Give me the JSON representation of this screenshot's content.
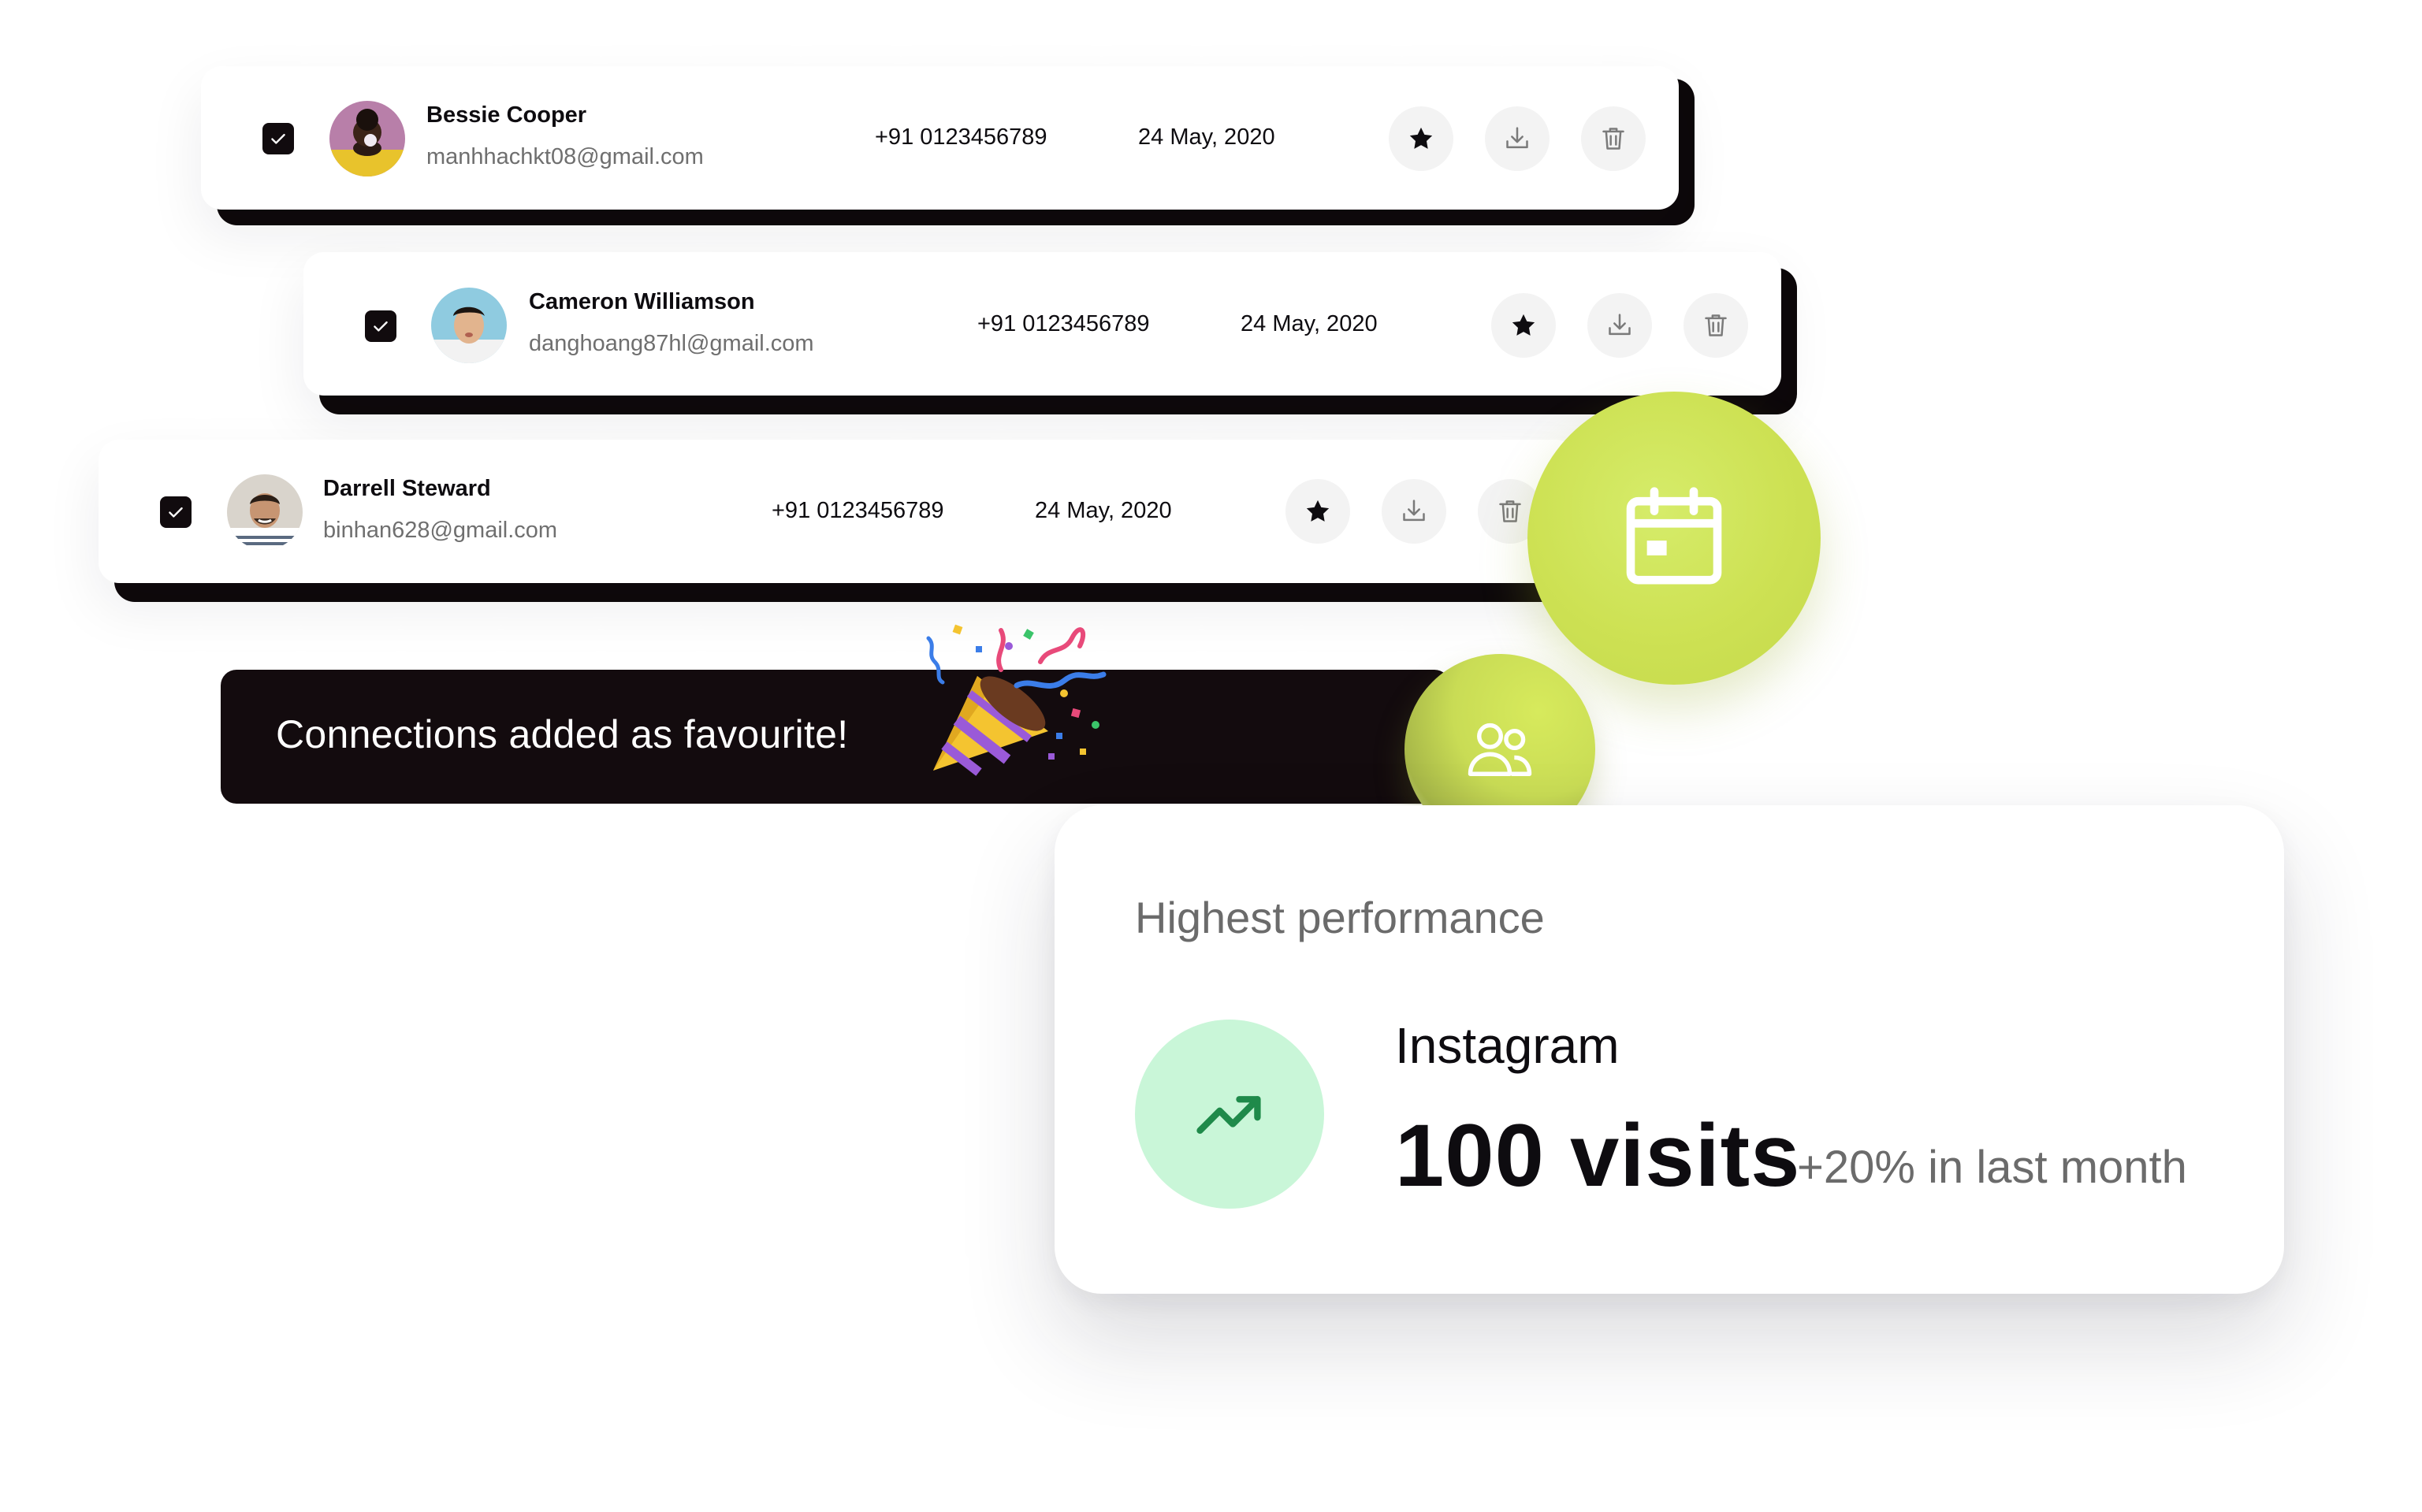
{
  "contacts": [
    {
      "name": "Bessie Cooper",
      "email": "manhhachkt08@gmail.com",
      "phone": "+91 0123456789",
      "date": "24 May, 2020",
      "checked": true
    },
    {
      "name": "Cameron Williamson",
      "email": "danghoang87hl@gmail.com",
      "phone": "+91 0123456789",
      "date": "24 May, 2020",
      "checked": true
    },
    {
      "name": "Darrell Steward",
      "email": "binhan628@gmail.com",
      "phone": "+91 0123456789",
      "date": "24 May, 2020",
      "checked": true
    }
  ],
  "row_actions": {
    "star_icon": "star-icon",
    "download_icon": "download-icon",
    "delete_icon": "trash-icon"
  },
  "toast": {
    "message": "Connections added as favourite!",
    "emoji": "party-popper"
  },
  "badges": {
    "calendar_icon": "calendar-icon",
    "users_icon": "users-icon"
  },
  "performance": {
    "title": "Highest performance",
    "platform": "Instagram",
    "visits": "100 visits",
    "change": "+20% in last month",
    "trend_icon": "trending-up-icon"
  },
  "colors": {
    "accent": "#cde153",
    "dark": "#130b0e",
    "trend_bg": "#c9f6d8",
    "trend_icon": "#1f8a4a",
    "muted": "#6f6f6f"
  }
}
